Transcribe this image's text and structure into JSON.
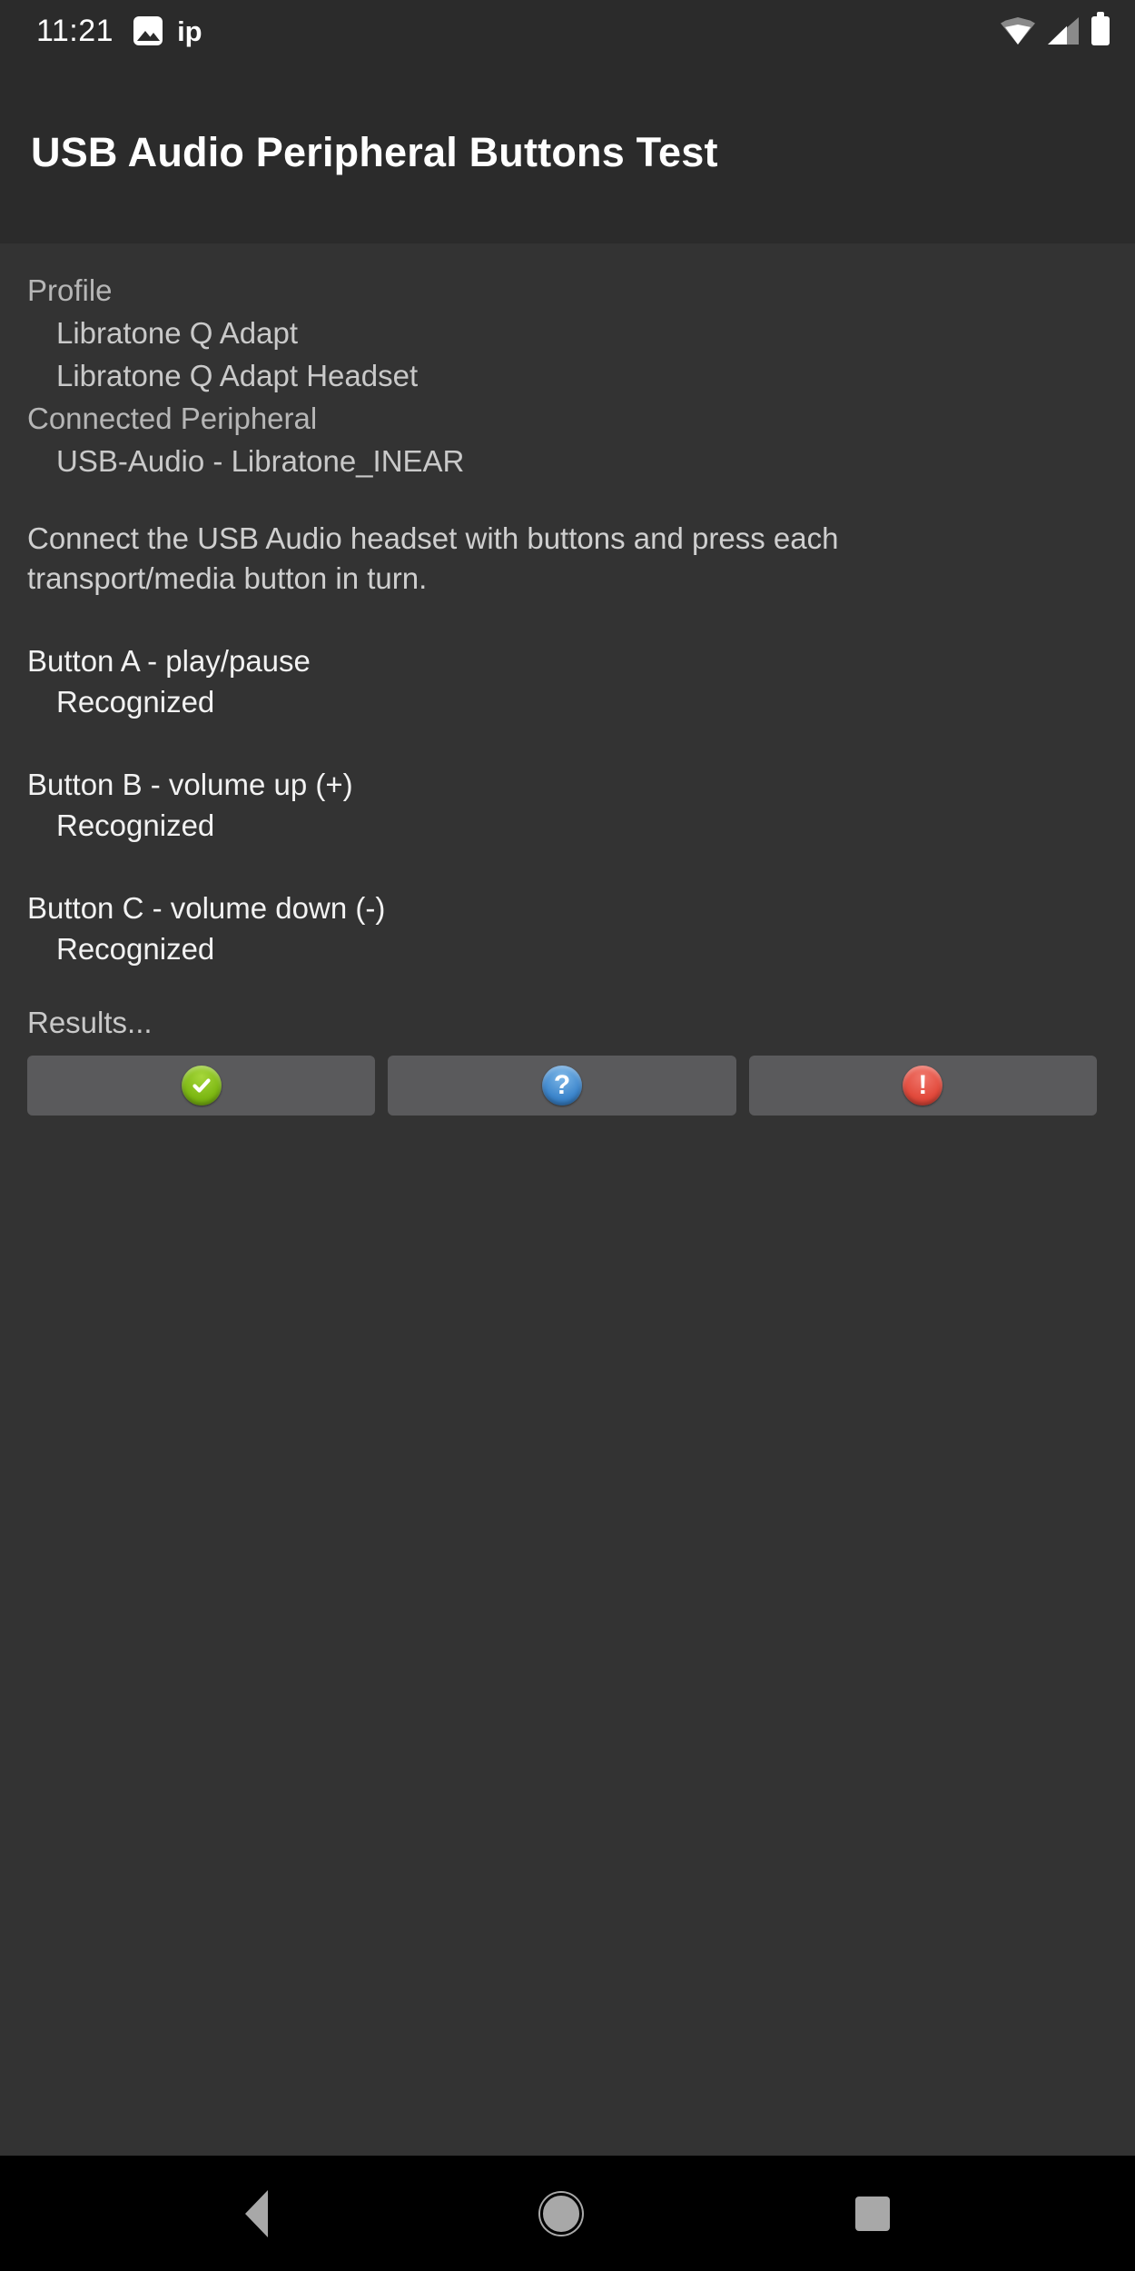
{
  "status_bar": {
    "clock": "11:21",
    "notification_text": "ip",
    "icons": {
      "photo": "photo-icon",
      "wifi": "wifi-icon",
      "cellular": "cellular-signal-icon",
      "battery": "battery-full-icon"
    }
  },
  "header": {
    "title": "USB Audio Peripheral Buttons Test"
  },
  "main": {
    "profile": {
      "label": "Profile",
      "values": [
        "Libratone Q Adapt",
        "Libratone Q Adapt Headset"
      ]
    },
    "connected_peripheral": {
      "label": "Connected Peripheral",
      "values": [
        "USB-Audio - Libratone_INEAR"
      ]
    },
    "instructions": "Connect the USB Audio headset with buttons and press each transport/media button in turn.",
    "button_tests": [
      {
        "title": "Button A - play/pause",
        "status": "Recognized"
      },
      {
        "title": "Button B - volume up (+)",
        "status": "Recognized"
      },
      {
        "title": "Button C - volume down (-)",
        "status": "Recognized"
      }
    ],
    "results_label": "Results...",
    "result_buttons": [
      {
        "name": "pass",
        "icon": "check-circle-icon",
        "glyph": "✔",
        "color": "#7db813"
      },
      {
        "name": "info",
        "icon": "question-circle-icon",
        "glyph": "?",
        "color": "#3d86cc"
      },
      {
        "name": "fail",
        "icon": "exclamation-circle-icon",
        "glyph": "!",
        "color": "#e24a3c"
      }
    ]
  },
  "nav_bar": {
    "back": "back-nav-icon",
    "home": "home-nav-icon",
    "recents": "recents-nav-icon"
  },
  "colors": {
    "status_bar_bg": "#2b2b2b",
    "app_bar_bg": "#2b2b2b",
    "content_bg": "#333333",
    "button_bg": "#5a5a5c",
    "nav_bg": "#000000",
    "pass_green": "#7db813",
    "info_blue": "#3d86cc",
    "fail_red": "#e24a3c"
  }
}
